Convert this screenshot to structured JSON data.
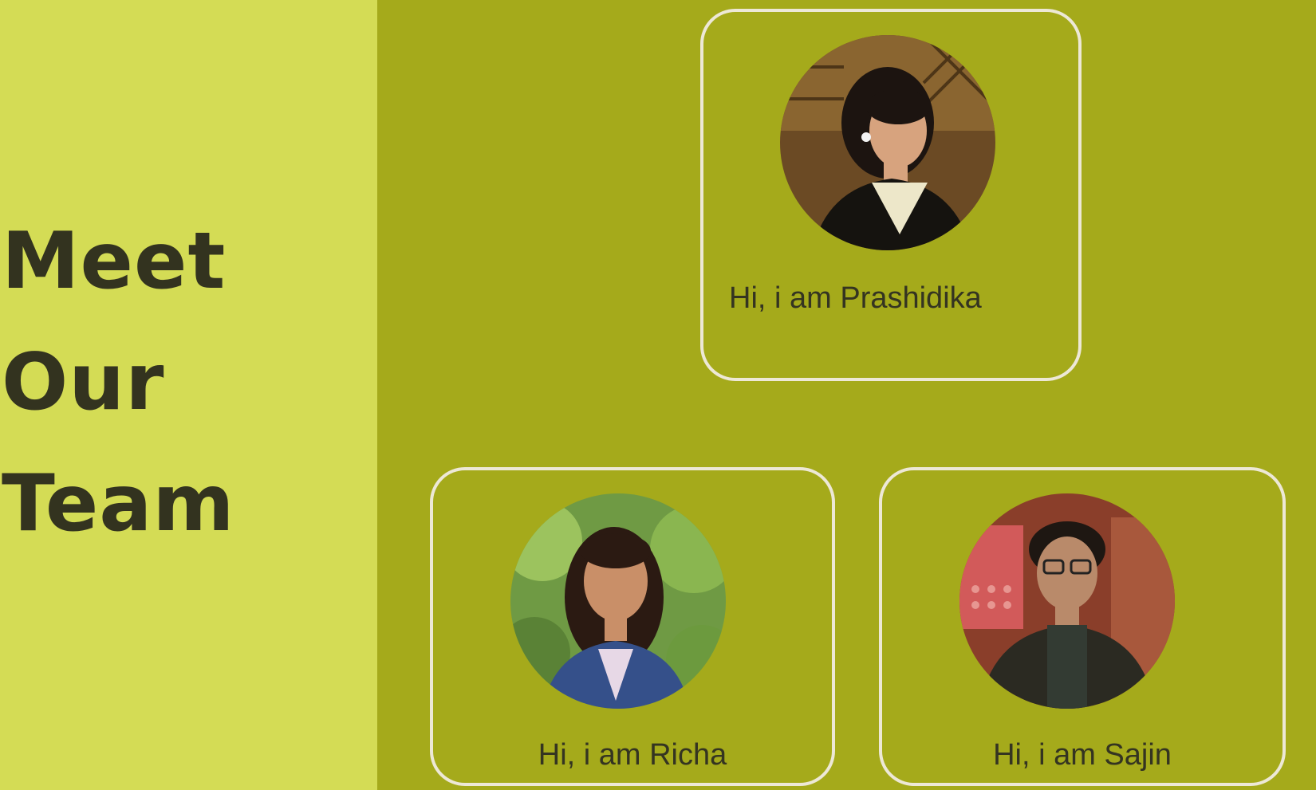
{
  "sidebar": {
    "heading_lines": [
      "Meet",
      "Our",
      "Team"
    ]
  },
  "team": [
    {
      "greeting": "Hi, i am Prashidika",
      "photo": "portrait-prashidika"
    },
    {
      "greeting": "Hi, i am Richa",
      "photo": "portrait-richa"
    },
    {
      "greeting": "Hi, i am Sajin",
      "photo": "portrait-sajin"
    }
  ],
  "colors": {
    "sidebar_bg": "#d4dc55",
    "main_bg": "#a5aa1b",
    "card_border": "#ede8d6",
    "text": "#343421"
  }
}
